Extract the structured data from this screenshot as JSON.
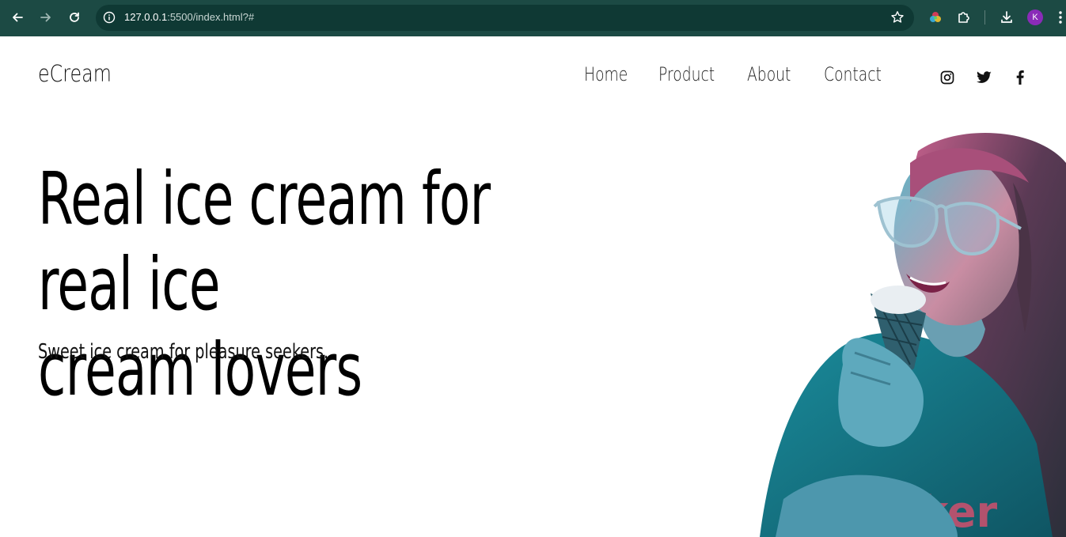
{
  "browser": {
    "url_host": "127.0.0.1",
    "url_path": ":5500/index.html?#",
    "avatar_letter": "K",
    "icons": [
      "back-arrow-icon",
      "forward-arrow-icon",
      "reload-icon",
      "site-info-icon",
      "bookmark-star-icon",
      "color-wheel-extension-icon",
      "extensions-puzzle-icon",
      "download-icon",
      "kebab-menu-icon"
    ],
    "colors": {
      "toolbar": "#1c4a44",
      "omnibox": "#0f3934",
      "avatar": "#8a2bb8"
    }
  },
  "site": {
    "logo": "eCream",
    "nav": [
      {
        "label": "Home"
      },
      {
        "label": "Product"
      },
      {
        "label": "About"
      },
      {
        "label": "Contact"
      }
    ],
    "social_icons": [
      "instagram-icon",
      "twitter-icon",
      "facebook-icon"
    ]
  },
  "hero": {
    "title_line1": "Real ice cream for real ice",
    "title_line2": "cream lovers",
    "subtitle": "Sweet ice cream for pleasure seekers.",
    "image_subject": "woman with glasses eating an ice cream cone",
    "image_shirt_text": "b ker"
  }
}
